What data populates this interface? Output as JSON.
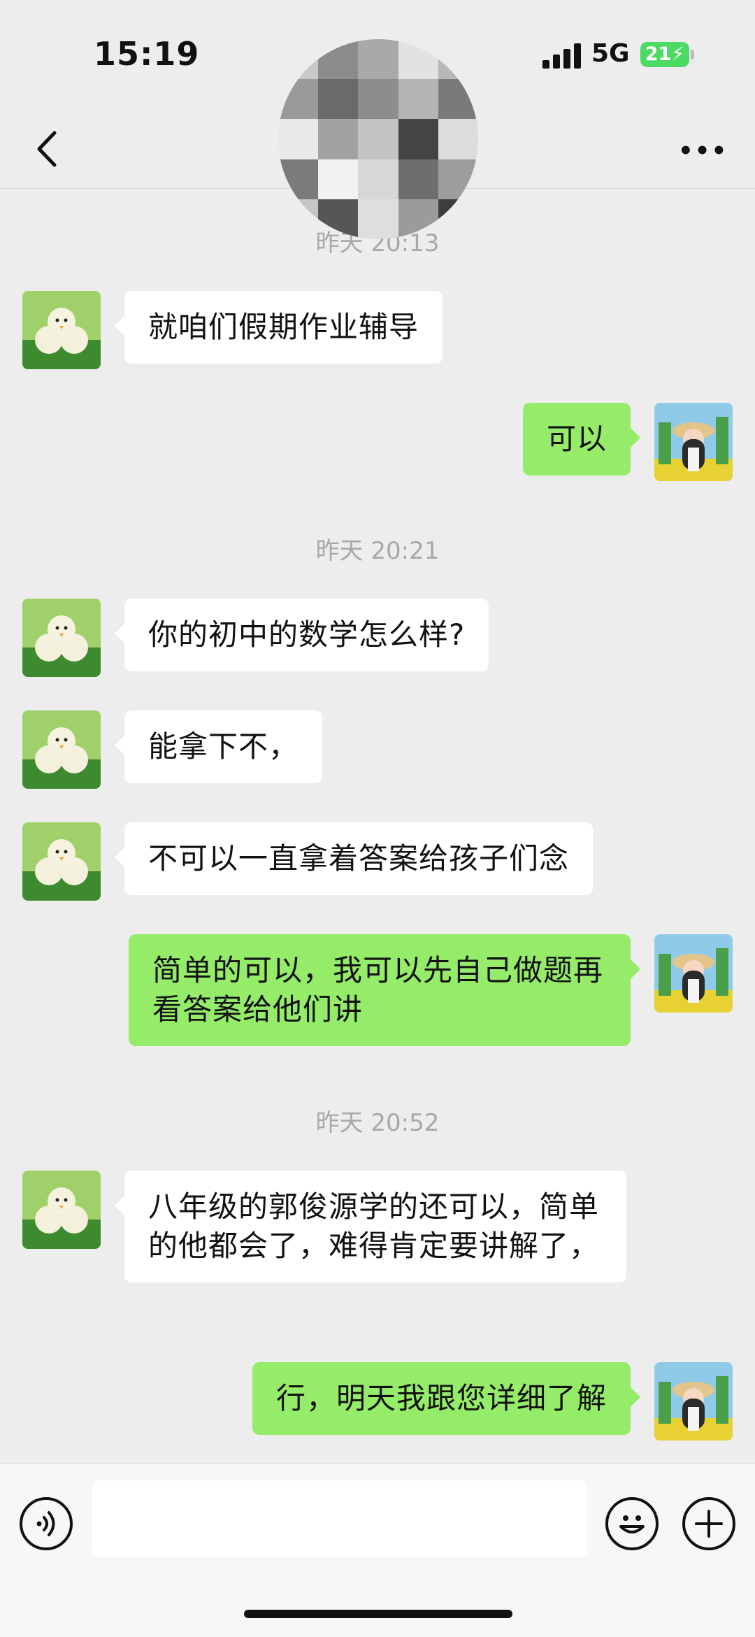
{
  "status_bar": {
    "time": "15:19",
    "network": "5G",
    "battery": "21"
  },
  "nav": {
    "more_label": "•••"
  },
  "timestamps": [
    "昨天 20:13",
    "昨天 20:21",
    "昨天 20:52"
  ],
  "messages": [
    {
      "from": "contact",
      "text": "就咱们假期作业辅导"
    },
    {
      "from": "me",
      "text": "可以"
    },
    {
      "from": "contact",
      "text": "你的初中的数学怎么样?"
    },
    {
      "from": "contact",
      "text": "能拿下不，"
    },
    {
      "from": "contact",
      "text": "不可以一直拿着答案给孩子们念"
    },
    {
      "from": "me",
      "text": "简单的可以，我可以先自己做题再看答案给他们讲"
    },
    {
      "from": "contact",
      "text": "八年级的郭俊源学的还可以，简单的他都会了，难得肯定要讲解了，"
    },
    {
      "from": "me",
      "text": "行，明天我跟您详细了解"
    }
  ],
  "input": {
    "placeholder": ""
  },
  "colors": {
    "background": "#ededed",
    "outgoing_bubble": "#95ec69",
    "incoming_bubble": "#ffffff",
    "battery": "#4cd964"
  }
}
